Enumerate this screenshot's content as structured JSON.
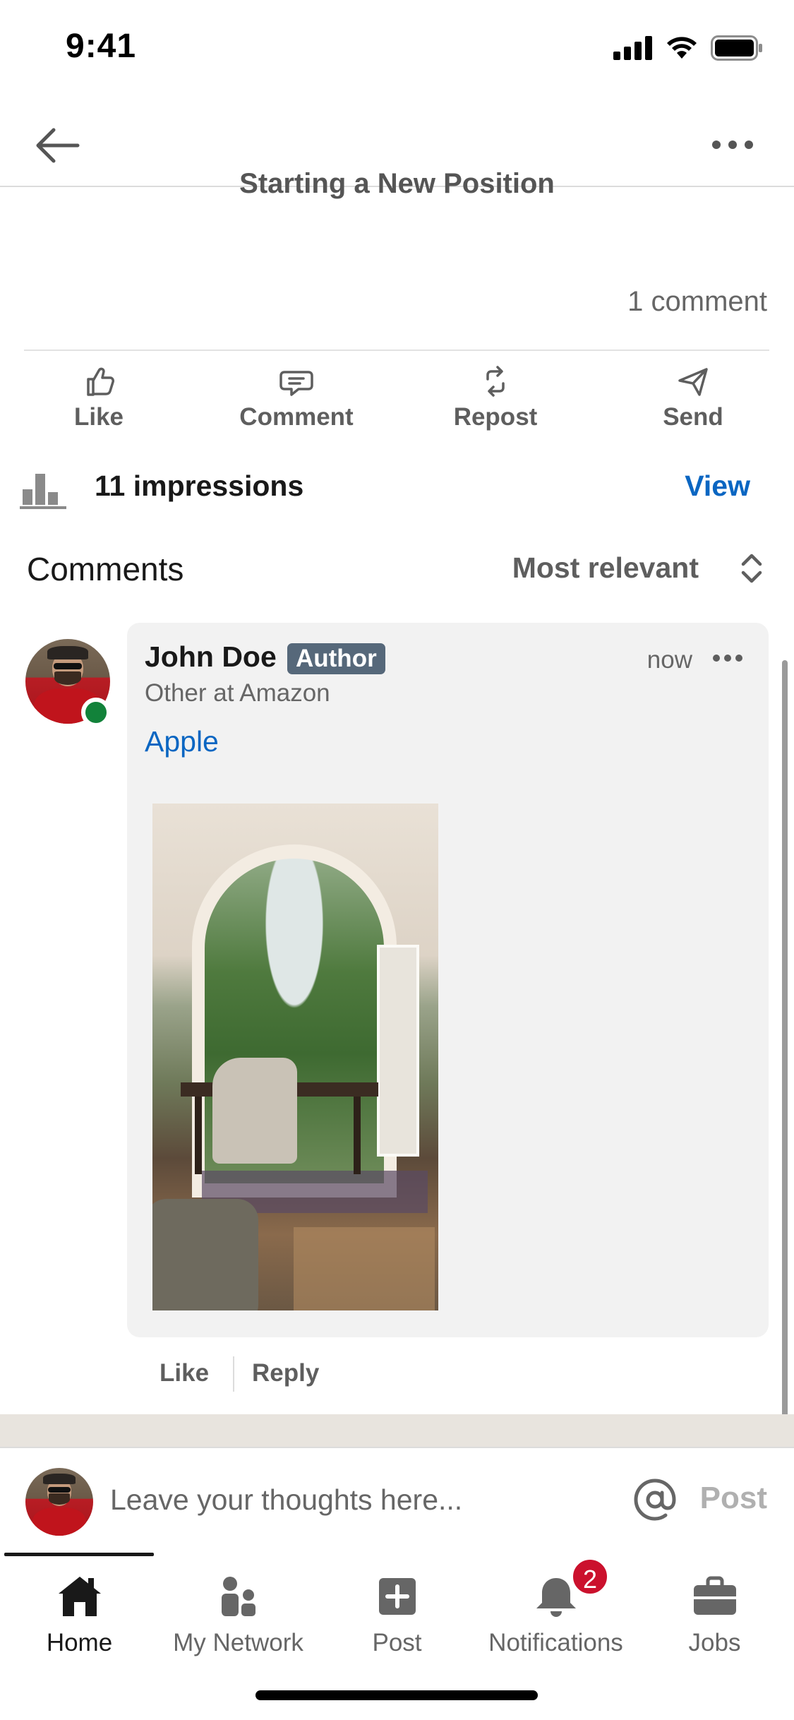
{
  "status_bar": {
    "time": "9:41"
  },
  "post": {
    "clipped_title": "Starting a New Position",
    "comment_count": "1 comment"
  },
  "actions": [
    {
      "label": "Like",
      "icon": "thumbs-up-icon"
    },
    {
      "label": "Comment",
      "icon": "comment-icon"
    },
    {
      "label": "Repost",
      "icon": "repost-icon"
    },
    {
      "label": "Send",
      "icon": "send-icon"
    }
  ],
  "impressions": {
    "text": "11 impressions",
    "view_label": "View"
  },
  "comments_header": {
    "title": "Comments",
    "sort_label": "Most relevant"
  },
  "comment": {
    "author": "John Doe",
    "badge": "Author",
    "time": "now",
    "headline": "Other at Amazon",
    "mention": "Apple",
    "like_label": "Like",
    "reply_label": "Reply"
  },
  "composer": {
    "placeholder": "Leave your thoughts here...",
    "post_label": "Post"
  },
  "tabs": [
    {
      "label": "Home",
      "icon": "home-icon",
      "active": true
    },
    {
      "label": "My Network",
      "icon": "network-icon"
    },
    {
      "label": "Post",
      "icon": "plus-square-icon"
    },
    {
      "label": "Notifications",
      "icon": "bell-icon",
      "badge": "2"
    },
    {
      "label": "Jobs",
      "icon": "briefcase-icon"
    }
  ],
  "colors": {
    "brand_blue": "#0a66c2",
    "badge_red": "#cb112d",
    "online_green": "#12823a",
    "author_badge": "#56687a"
  }
}
